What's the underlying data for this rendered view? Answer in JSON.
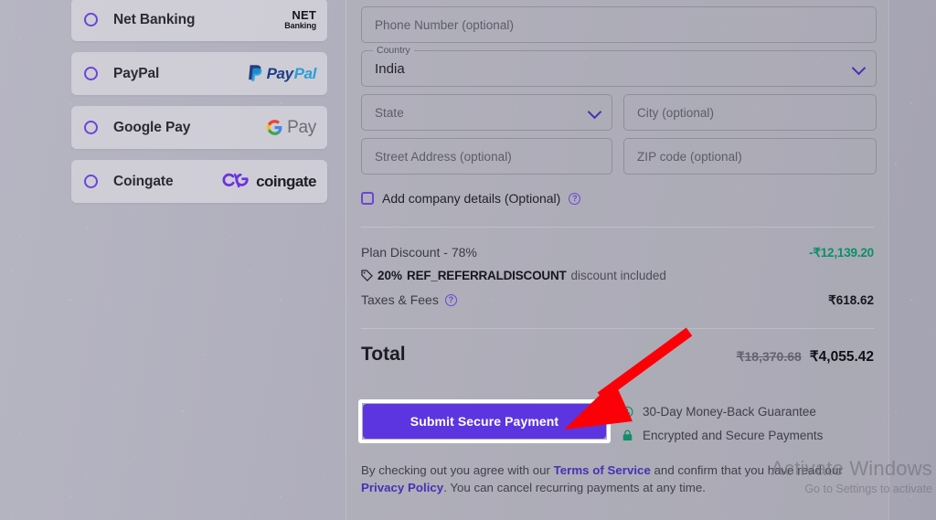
{
  "payment_methods": [
    {
      "id": "net-banking",
      "label": "Net Banking",
      "logo": "netbanking-logo",
      "logo_line1": "NET",
      "logo_line2": "Banking",
      "selected": false
    },
    {
      "id": "paypal",
      "label": "PayPal",
      "logo": "paypal-logo",
      "logo_text_1": "Pay",
      "logo_text_2": "Pal",
      "selected": false
    },
    {
      "id": "google-pay",
      "label": "Google Pay",
      "logo": "google-pay-logo",
      "logo_text": "Pay",
      "selected": false
    },
    {
      "id": "coingate",
      "label": "Coingate",
      "logo": "coingate-logo",
      "logo_text": "coingate",
      "selected": false
    }
  ],
  "form": {
    "phone": {
      "placeholder": "Phone Number (optional)",
      "value": ""
    },
    "country": {
      "label": "Country",
      "value": "India"
    },
    "state": {
      "placeholder": "State",
      "value": ""
    },
    "city": {
      "placeholder": "City (optional)",
      "value": ""
    },
    "street": {
      "placeholder": "Street Address (optional)",
      "value": ""
    },
    "zip": {
      "placeholder": "ZIP code (optional)",
      "value": ""
    },
    "company_checkbox": {
      "label": "Add company details (Optional)",
      "checked": false,
      "help": "?"
    }
  },
  "summary": {
    "plan_discount_label": "Plan Discount - 78%",
    "plan_discount_amount": "-₹12,139.20",
    "promo_percent": "20%",
    "promo_code": "REF_REFERRALDISCOUNT",
    "promo_tail": "discount included",
    "taxes_label": "Taxes & Fees",
    "taxes_help": "?",
    "taxes_amount": "₹618.62",
    "total_label": "Total",
    "total_original": "₹18,370.68",
    "total_final": "₹4,055.42"
  },
  "actions": {
    "submit_label": "Submit Secure Payment"
  },
  "guarantees": [
    {
      "icon": "clock-refund-icon",
      "label": "30-Day Money-Back Guarantee"
    },
    {
      "icon": "lock-icon",
      "label": "Encrypted and Secure Payments"
    }
  ],
  "terms": {
    "part1": "By checking out you agree with our ",
    "link1": "Terms of Service",
    "part2": " and confirm that you have read our ",
    "link2": "Privacy Policy",
    "part3": ". You can cancel recurring payments at any time."
  },
  "watermark": {
    "line1": "Activate Windows",
    "line2": "Go to Settings to activate"
  },
  "colors": {
    "accent": "#5d35e0",
    "discount_green": "#0c8f66",
    "link": "#4631b5",
    "annotation_red": "#fb0007"
  }
}
